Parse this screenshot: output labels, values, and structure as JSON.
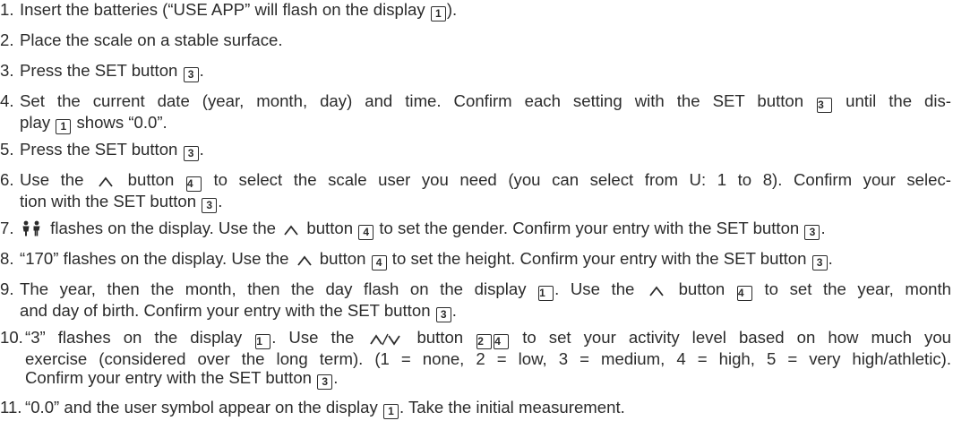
{
  "steps": [
    {
      "num": "1.",
      "text": "Insert the batteries (“USE APP” will flash on the display ",
      "ref": "1",
      "tail": ")."
    },
    {
      "num": "2.",
      "text": "Place the scale on a stable surface."
    },
    {
      "num": "3.",
      "text": "Press the SET button ",
      "ref": "3",
      "tail": "."
    },
    {
      "num": "4.",
      "line1": {
        "a": "Set the current date (year, month, day) and time. Confirm each setting with the SET button ",
        "ref": "3",
        "b": " until the dis-"
      },
      "line2": {
        "a": "play ",
        "ref": "1",
        "b": " shows “0.0”."
      }
    },
    {
      "num": "5.",
      "text": "Press the SET button ",
      "ref": "3",
      "tail": "."
    },
    {
      "num": "6.",
      "line1": {
        "a": "Use the ",
        "ref": "4",
        "b": " to select the scale user you need (you can select from U: 1 to 8). Confirm your selec-"
      },
      "line2": {
        "a": "tion with the SET button ",
        "ref": "3",
        "b": "."
      }
    },
    {
      "num": "7.",
      "a": " flashes on the display. Use the ",
      "b": " button ",
      "ref": "4",
      "c": " to set the gender. Confirm your entry with the SET button ",
      "ref2": "3",
      "d": "."
    },
    {
      "num": "8.",
      "a": "“170” flashes on the display. Use the ",
      "b": " button ",
      "ref": "4",
      "c": " to set the height. Confirm your entry with the SET button ",
      "ref2": "3",
      "d": "."
    },
    {
      "num": "9.",
      "line1": {
        "a": "The year, then the month, then the day flash on the display ",
        "ref": "1",
        "b": ". Use the ",
        "c": " button ",
        "ref2": "4",
        "d": " to set the year, month"
      },
      "line2": {
        "a": "and day of birth. Confirm your entry with the SET button ",
        "ref": "3",
        "b": "."
      }
    },
    {
      "num": "10.",
      "line1": {
        "a": "“3” flashes on the display ",
        "ref": "1",
        "b": ". Use the ",
        "c": " button ",
        "ref2": "2",
        "ref3": "4",
        "d": " to set your activity level based on how much you"
      },
      "line2": "exercise (considered over the long term). (1 = none, 2 = low, 3 = medium, 4 = high, 5 = very high/athletic).",
      "line3": {
        "a": "Confirm your entry with the SET button ",
        "ref": "3",
        "b": "."
      }
    },
    {
      "num": "11.",
      "a": "“0.0” and the user symbol appear on the display ",
      "ref": "1",
      "b": ". Take the initial measurement."
    }
  ],
  "icons": {
    "up_arrow": "up-arrow-icon",
    "down_arrow": "down-arrow-icon",
    "gender": "gender-icon"
  },
  "colors": {
    "text": "#2b2b2b",
    "background": "#ffffff"
  }
}
